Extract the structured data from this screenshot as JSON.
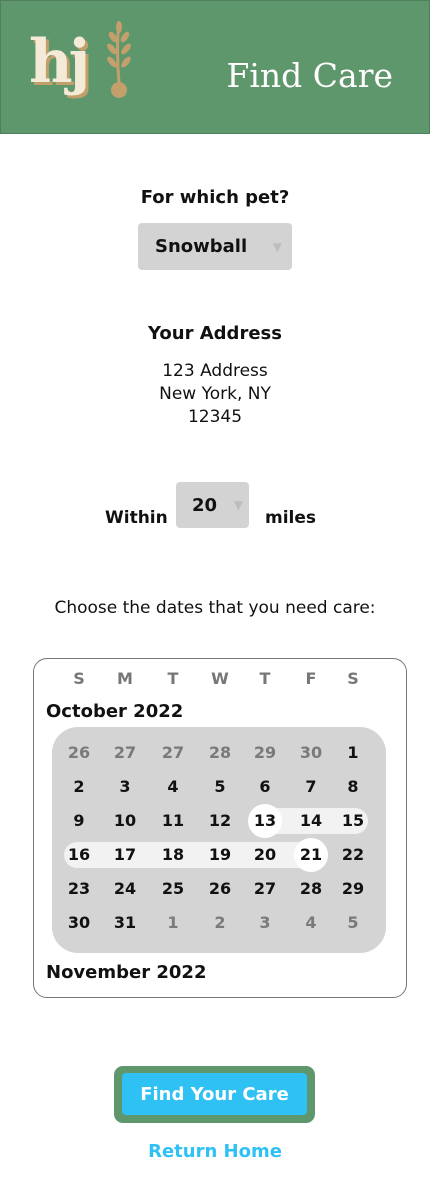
{
  "header": {
    "logo_text": "hj",
    "title": "Find Care",
    "background_color": "#5f976c"
  },
  "pet": {
    "label": "For which pet?",
    "selected": "Snowball",
    "chevron_icon": "chevron-down-icon"
  },
  "address": {
    "label": "Your Address",
    "line1": "123 Address",
    "line2": "New York, NY",
    "line3": "12345"
  },
  "distance": {
    "prefix": "Within",
    "value": "20",
    "suffix": "miles"
  },
  "dates": {
    "prompt": "Choose the dates that you need care:"
  },
  "calendar": {
    "weekdays": [
      "S",
      "M",
      "T",
      "W",
      "T",
      "F",
      "S"
    ],
    "current_month": "October 2022",
    "next_month": "November 2022",
    "weeks": [
      [
        {
          "d": "26",
          "m": true
        },
        {
          "d": "27",
          "m": true
        },
        {
          "d": "27",
          "m": true
        },
        {
          "d": "28",
          "m": true
        },
        {
          "d": "29",
          "m": true
        },
        {
          "d": "30",
          "m": true
        },
        {
          "d": "1"
        }
      ],
      [
        {
          "d": "2"
        },
        {
          "d": "3"
        },
        {
          "d": "4"
        },
        {
          "d": "5"
        },
        {
          "d": "6"
        },
        {
          "d": "7"
        },
        {
          "d": "8"
        }
      ],
      [
        {
          "d": "9"
        },
        {
          "d": "10"
        },
        {
          "d": "11"
        },
        {
          "d": "12"
        },
        {
          "d": "13",
          "sel": true
        },
        {
          "d": "14"
        },
        {
          "d": "15"
        }
      ],
      [
        {
          "d": "16"
        },
        {
          "d": "17"
        },
        {
          "d": "18"
        },
        {
          "d": "19"
        },
        {
          "d": "20"
        },
        {
          "d": "21",
          "sel": true
        },
        {
          "d": "22"
        }
      ],
      [
        {
          "d": "23"
        },
        {
          "d": "24"
        },
        {
          "d": "25"
        },
        {
          "d": "26"
        },
        {
          "d": "27"
        },
        {
          "d": "28"
        },
        {
          "d": "29"
        }
      ],
      [
        {
          "d": "30"
        },
        {
          "d": "31"
        },
        {
          "d": "1",
          "m": true
        },
        {
          "d": "2",
          "m": true
        },
        {
          "d": "3",
          "m": true
        },
        {
          "d": "4",
          "m": true
        },
        {
          "d": "5",
          "m": true
        }
      ]
    ],
    "range_start": "13",
    "range_end": "21"
  },
  "actions": {
    "find_care": "Find Your Care",
    "return_home": "Return Home",
    "accent_color": "#2fc0f4"
  }
}
